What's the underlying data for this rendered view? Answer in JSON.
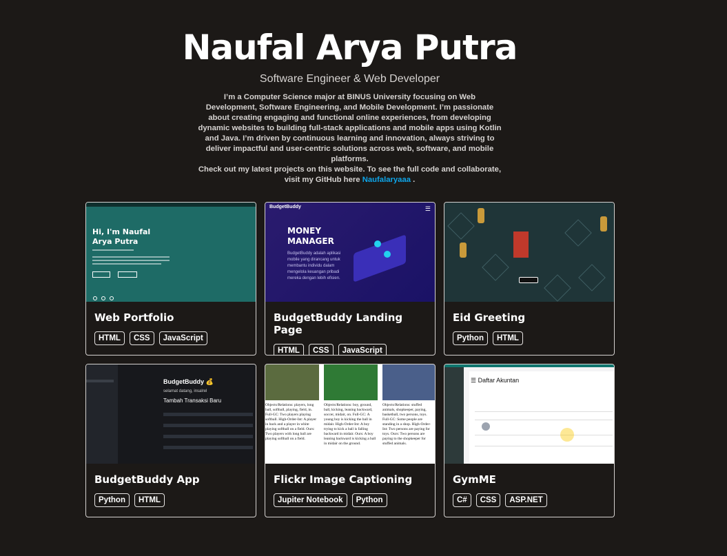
{
  "header": {
    "name": "Naufal Arya Putra",
    "role": "Software Engineer & Web Developer",
    "bio": "I’m a Computer Science major at BINUS University focusing on Web Development, Software Engineering, and Mobile Development. I’m passionate about creating engaging and functional online experiences, from developing dynamic websites to building full-stack applications and mobile apps using Kotlin and Java. I’m driven by continuous learning and innovation, always striving to deliver impactful and user-centric solutions across web, software, and mobile platforms.",
    "cta_before": "Check out my latest projects on this website. To see the full code and collaborate, visit my GitHub here",
    "github_link": "Naufalaryaaa",
    "cta_after": "."
  },
  "projects": [
    {
      "title": "Web Portfolio",
      "tags": [
        "HTML",
        "CSS",
        "JavaScript"
      ],
      "thumb": {
        "heading": "Hi, I'm Naufal Arya Putra"
      }
    },
    {
      "title": "BudgetBuddy Landing Page",
      "tags": [
        "HTML",
        "CSS",
        "JavaScript"
      ],
      "thumb": {
        "brand": "BudgetBuddy",
        "heading": "MONEY MANAGER",
        "text": "BudgetBuddy adalah aplikasi mobile yang dirancang untuk membantu individu dalam mengelola keuangan pribadi mereka dengan lebih efisien."
      }
    },
    {
      "title": "Eid Greeting",
      "tags": [
        "Python",
        "HTML"
      ],
      "thumb": {}
    },
    {
      "title": "BudgetBuddy App",
      "tags": [
        "Python",
        "HTML"
      ],
      "thumb": {
        "heading": "BudgetBuddy 💰",
        "sub": "selamat datang, insalrel",
        "form_title": "Tambah Transaksi Baru"
      }
    },
    {
      "title": "Flickr Image Captioning",
      "tags": [
        "Jupiter Notebook",
        "Python"
      ],
      "thumb": {
        "col1": "Objects/Relations: players, long ball, softball, playing, field, in. Full-GC: Two players playing softball. High-Order-Int: A player in back and a player in white playing softball on a field. Ours: Two players with long ball are playing softball on a field.",
        "col2": "Objects/Relations: boy, ground, ball, kicking, leaning backward, soccer, midair, on. Full-GC: A young boy is kicking the ball in midair. High-Order-Int: A boy trying to kick a ball is falling backward in midair. Ours: A boy leaning backward is kicking a ball in midair on the ground.",
        "col3": "Objects/Relations: stuffed animals, shopkeeper, paying, basketball, two persons, toys. Full-GC: Some people are standing in a shop. High-Order-Int: Two persons are paying for toys. Ours: Two persons are paying to the shopkeeper for stuffed animals."
      }
    },
    {
      "title": "GymME",
      "tags": [
        "C#",
        "CSS",
        "ASP.NET"
      ],
      "thumb": {
        "heading": "☰ Daftar Akuntan"
      }
    }
  ],
  "colors": {
    "background": "#1c1917",
    "link": "#0ea5e9",
    "card_border": "#d6d3d1"
  }
}
